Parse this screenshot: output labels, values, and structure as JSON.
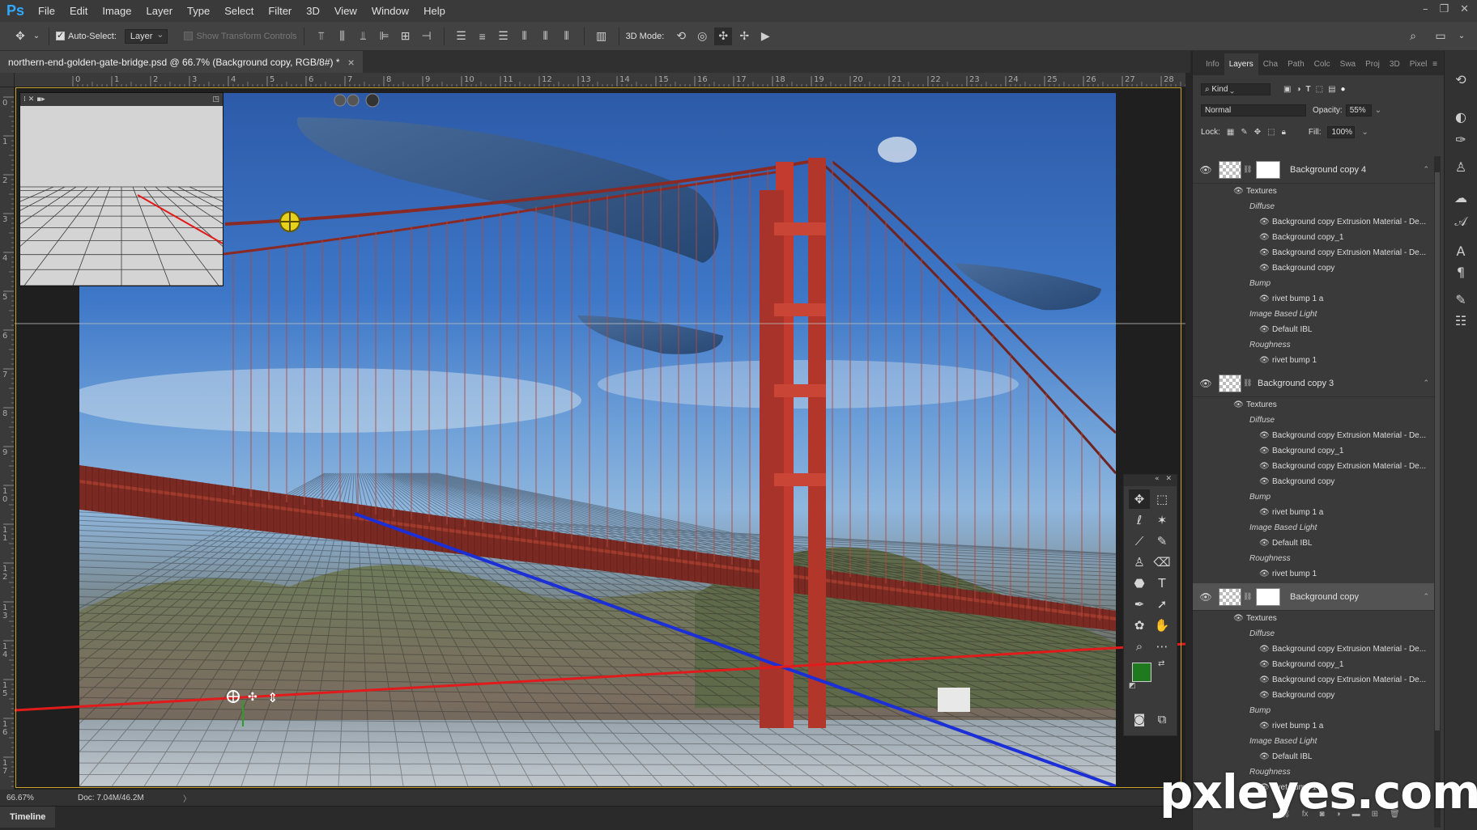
{
  "app": {
    "logo": "Ps"
  },
  "menu": [
    "File",
    "Edit",
    "Image",
    "Layer",
    "Type",
    "Select",
    "Filter",
    "3D",
    "View",
    "Window",
    "Help"
  ],
  "window_controls": {
    "minimize": "–",
    "restore": "❐",
    "close": "✕"
  },
  "options": {
    "auto_select_label": "Auto-Select:",
    "auto_select_value": "Layer",
    "show_transform_label": "Show Transform Controls",
    "mode_3d_label": "3D Mode:"
  },
  "document": {
    "tab_title": "northern-end-golden-gate-bridge.psd @ 66.7% (Background copy, RGB/8#) *",
    "close": "×"
  },
  "rulers": {
    "top": [
      "0",
      "1",
      "2",
      "3",
      "4",
      "5",
      "6",
      "7",
      "8",
      "9",
      "10",
      "11",
      "12",
      "13",
      "14",
      "15",
      "16",
      "17",
      "18",
      "19",
      "20",
      "21",
      "22",
      "23",
      "24",
      "25",
      "26",
      "27",
      "28"
    ],
    "left": [
      "0",
      "1",
      "2",
      "3",
      "4",
      "5",
      "6",
      "7",
      "8",
      "9",
      "10",
      "11",
      "12",
      "13",
      "14",
      "15",
      "16",
      "17"
    ]
  },
  "status": {
    "zoom": "66.67%",
    "doc": "Doc: 7.04M/46.2M",
    "arrow": "〉",
    "timeline": "Timeline"
  },
  "panel": {
    "tabs": [
      "Info",
      "Layers",
      "Cha",
      "Path",
      "Colc",
      "Swa",
      "Proj",
      "3D",
      "Pixel"
    ],
    "active_tab": "Layers",
    "kind": "Kind",
    "blend_mode": "Normal",
    "opacity_label": "Opacity:",
    "opacity_value": "55%",
    "lock_label": "Lock:",
    "fill_label": "Fill:",
    "fill_value": "100%",
    "layers": [
      {
        "name": "Background copy 4",
        "selected": false,
        "has_mask": true,
        "textures_label": "Textures",
        "groups": [
          {
            "label": "Diffuse",
            "items": [
              "Background copy Extrusion Material - De...",
              "Background copy_1",
              "Background copy Extrusion Material - De...",
              "Background copy"
            ]
          },
          {
            "label": "Bump",
            "items": [
              "rivet bump 1 a"
            ]
          },
          {
            "label": "Image Based Light",
            "items": [
              "Default IBL"
            ]
          },
          {
            "label": "Roughness",
            "items": [
              "rivet bump 1"
            ]
          }
        ]
      },
      {
        "name": "Background copy 3",
        "selected": false,
        "has_mask": false,
        "textures_label": "Textures",
        "groups": [
          {
            "label": "Diffuse",
            "items": [
              "Background copy Extrusion Material - De...",
              "Background copy_1",
              "Background copy Extrusion Material - De...",
              "Background copy"
            ]
          },
          {
            "label": "Bump",
            "items": [
              "rivet bump 1 a"
            ]
          },
          {
            "label": "Image Based Light",
            "items": [
              "Default IBL"
            ]
          },
          {
            "label": "Roughness",
            "items": [
              "rivet bump 1"
            ]
          }
        ]
      },
      {
        "name": "Background copy",
        "selected": true,
        "has_mask": true,
        "textures_label": "Textures",
        "groups": [
          {
            "label": "Diffuse",
            "items": [
              "Background copy Extrusion Material - De...",
              "Background copy_1",
              "Background copy Extrusion Material - De...",
              "Background copy"
            ]
          },
          {
            "label": "Bump",
            "items": [
              "rivet bump 1 a"
            ]
          },
          {
            "label": "Image Based Light",
            "items": [
              "Default IBL"
            ]
          },
          {
            "label": "Roughness",
            "items": [
              "rivet bump 1"
            ]
          }
        ]
      }
    ]
  },
  "colors": {
    "accent": "#31a8ff",
    "foreground": "#1f7a1f",
    "background": "#ffffff",
    "bridge": "#c23b2e",
    "axis_x": "#e11b1b",
    "axis_z": "#1c2fd6",
    "canvas_border": "#c8a32b"
  },
  "watermark": "pxleyes.com"
}
